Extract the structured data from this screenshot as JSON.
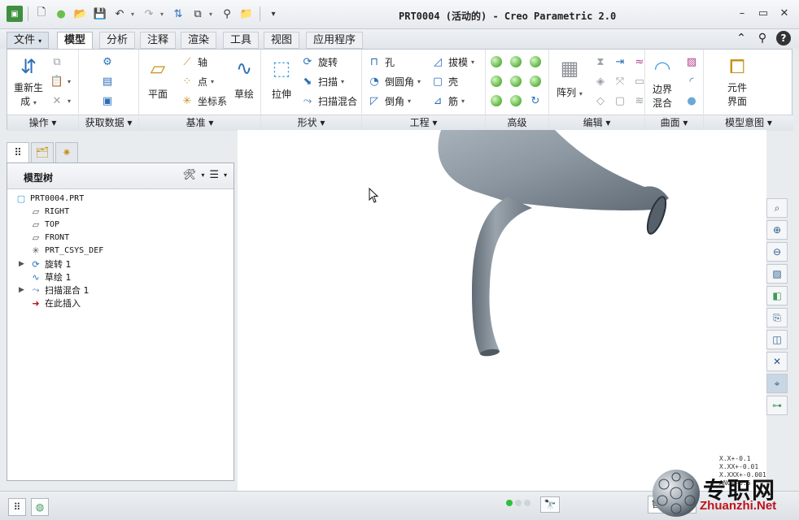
{
  "window": {
    "title": "PRT0004 (活动的) - Creo Parametric 2.0"
  },
  "tabs": [
    {
      "label": "文件",
      "id": "file"
    },
    {
      "label": "模型",
      "id": "model"
    },
    {
      "label": "分析",
      "id": "analysis"
    },
    {
      "label": "注释",
      "id": "annotate"
    },
    {
      "label": "渲染",
      "id": "render"
    },
    {
      "label": "工具",
      "id": "tools"
    },
    {
      "label": "视图",
      "id": "view"
    },
    {
      "label": "应用程序",
      "id": "applications"
    }
  ],
  "ribbon": {
    "operations": {
      "regen_line1": "重新生",
      "regen_line2": "成",
      "label": "操作"
    },
    "get_data": {
      "label": "获取数据"
    },
    "datum": {
      "plane": "平面",
      "axis": "轴",
      "point": "点",
      "csys": "坐标系",
      "sketch": "草绘",
      "label": "基准"
    },
    "shapes": {
      "extrude": "拉伸",
      "revolve": "旋转",
      "sweep": "扫描",
      "swept_blend": "扫描混合",
      "label": "形状"
    },
    "engineering": {
      "hole": "孔",
      "round": "倒圆角",
      "chamfer": "倒角",
      "draft": "拔模",
      "shell": "壳",
      "rib": "筋",
      "label": "工程"
    },
    "advanced": {
      "label": "高级"
    },
    "editing": {
      "pattern": "阵列",
      "label": "编辑"
    },
    "surfaces": {
      "boundary_line1": "边界",
      "boundary_line2": "混合",
      "label": "曲面"
    },
    "model_intent": {
      "component_line1": "元件",
      "component_line2": "界面",
      "label": "模型意图"
    }
  },
  "model_tree": {
    "title": "模型树",
    "items": [
      {
        "label": "PRT0004.PRT",
        "icon": "part-icon",
        "mono": true,
        "expandable": false
      },
      {
        "label": "RIGHT",
        "icon": "datum-plane-icon",
        "mono": true,
        "expandable": false
      },
      {
        "label": "TOP",
        "icon": "datum-plane-icon",
        "mono": true,
        "expandable": false
      },
      {
        "label": "FRONT",
        "icon": "datum-plane-icon",
        "mono": true,
        "expandable": false
      },
      {
        "label": "PRT_CSYS_DEF",
        "icon": "csys-icon",
        "mono": true,
        "expandable": false
      },
      {
        "label": "旋转 1",
        "icon": "revolve-icon",
        "mono": false,
        "expandable": true
      },
      {
        "label": "草绘 1",
        "icon": "sketch-icon",
        "mono": false,
        "expandable": false
      },
      {
        "label": "扫描混合 1",
        "icon": "swept-blend-icon",
        "mono": false,
        "expandable": true
      },
      {
        "label": "在此插入",
        "icon": "insert-here-icon",
        "mono": false,
        "expandable": false
      }
    ]
  },
  "tolerance": {
    "line1": "X.X+-0.1",
    "line2": "X.XX+-0.01",
    "line3": "X.XXX+-0.001",
    "line4": "ANG+-0.5"
  },
  "status": {
    "filter_value": "智能"
  },
  "watermark": {
    "cn": "专职网",
    "en": "Zhuanzhi.Net"
  },
  "colors": {
    "accent": "#2b6fb8",
    "model_gray": "#8b96a0",
    "status_green": "#2fbf3a",
    "watermark_red": "#c0121a"
  }
}
